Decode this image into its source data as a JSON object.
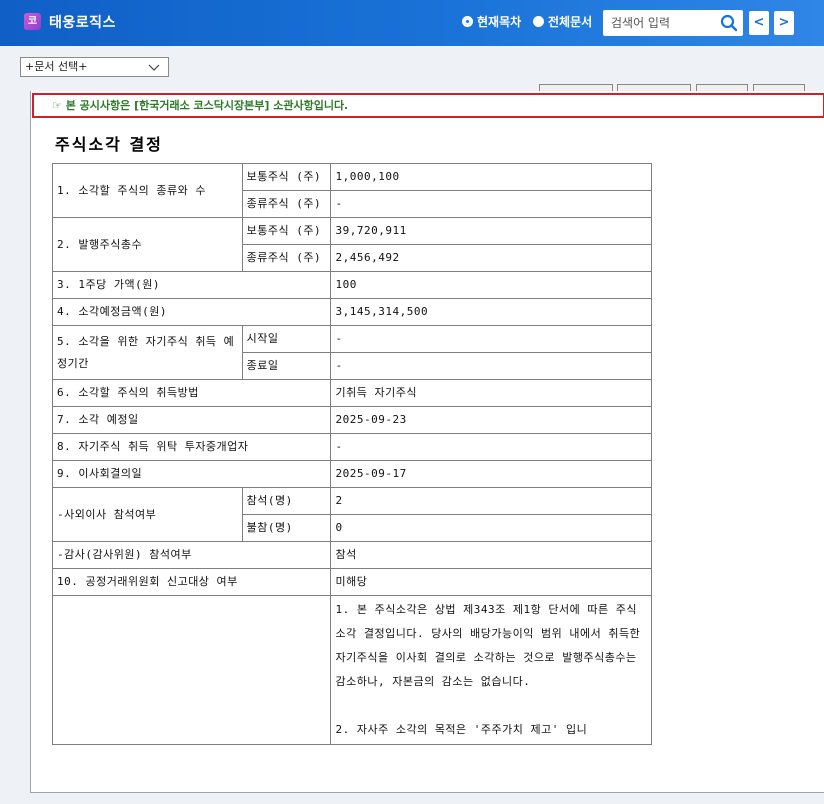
{
  "header": {
    "logo_glyph": "코",
    "company": "태웅로직스",
    "radio_current": "현재목차",
    "radio_all": "전체문서",
    "search_placeholder": "검색어 입력",
    "prev_glyph": "<",
    "next_glyph": ">"
  },
  "toolbar": {
    "doc_select": "+문서 선택+"
  },
  "notice": "☞ 본 공시사항은 [한국거래소 코스닥시장본부] 소관사항입니다.",
  "doc_title": "주식소각 결정",
  "table": {
    "r1_label": "1. 소각할 주식의 종류와 수",
    "r1_common_label": "보통주식 (주)",
    "r1_common_value": "1,000,100",
    "r1_class_label": "종류주식 (주)",
    "r1_class_value": "-",
    "r2_label": "2. 발행주식총수",
    "r2_common_label": "보통주식 (주)",
    "r2_common_value": "39,720,911",
    "r2_class_label": "종류주식 (주)",
    "r2_class_value": "2,456,492",
    "r3_label": "3. 1주당 가액(원)",
    "r3_value": "100",
    "r4_label": "4. 소각예정금액(원)",
    "r4_value": "3,145,314,500",
    "r5_label": "5. 소각을 위한 자기주식 취득 예정기간",
    "r5_start_label": "시작일",
    "r5_start_value": "-",
    "r5_end_label": "종료일",
    "r5_end_value": "-",
    "r6_label": "6. 소각할 주식의 취득방법",
    "r6_value": "기취득 자기주식",
    "r7_label": "7. 소각 예정일",
    "r7_value": "2025-09-23",
    "r8_label": "8. 자기주식 취득 위탁 투자중개업자",
    "r8_value": "-",
    "r9_label": "9. 이사회결의일",
    "r9_value": "2025-09-17",
    "r9a_label": "-사외이사 참석여부",
    "r9a_present_label": "참석(명)",
    "r9a_present_value": "2",
    "r9a_absent_label": "불참(명)",
    "r9a_absent_value": "0",
    "r9b_label": "-감사(감사위원) 참석여부",
    "r9b_value": "참석",
    "r10_label": "10. 공정거래위원회 신고대상 여부",
    "r10_value": "미해당",
    "r11_note1": "1. 본 주식소각은 상법 제343조 제1항 단서에 따른 주식 소각 결정입니다. 당사의 배당가능이익 범위 내에서 취득한 자기주식을 이사회 결의로 소각하는 것으로 발행주식총수는 감소하나, 자본금의 감소는 없습니다.",
    "r11_note2": "2. 자사주 소각의 목적은 '주주가치 제고' 입니"
  }
}
